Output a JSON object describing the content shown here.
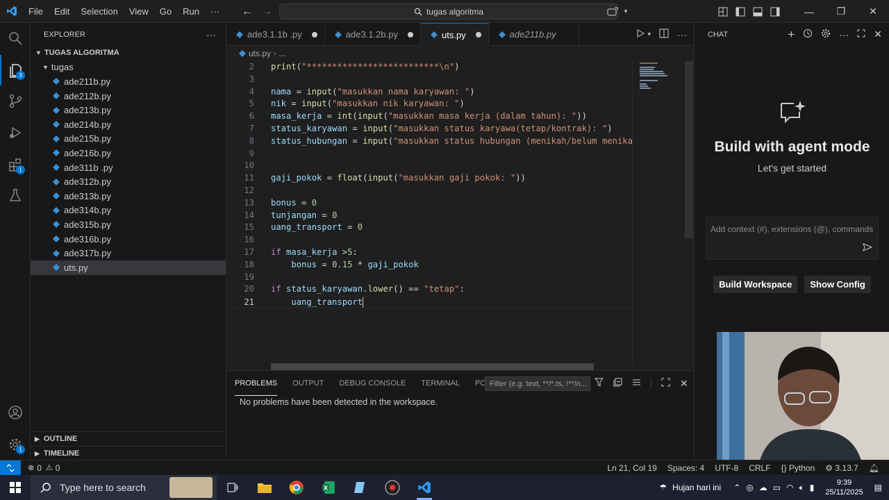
{
  "menu": [
    "File",
    "Edit",
    "Selection",
    "View",
    "Go",
    "Run",
    "···"
  ],
  "search": {
    "text": "tugas algoritma"
  },
  "explorer": {
    "header": "EXPLORER",
    "workspace": "TUGAS ALGORITMA",
    "folder": "tugas",
    "files": [
      "ade211b.py",
      "ade212b.py",
      "ade213b.py",
      "ade214b.py",
      "ade215b.py",
      "ade216b.py",
      "ade311b .py",
      "ade312b.py",
      "ade313b.py",
      "ade314b.py",
      "ade315b.py",
      "ade316b.py",
      "ade317b.py",
      "uts.py"
    ],
    "selected": "uts.py",
    "outline": "OUTLINE",
    "timeline": "TIMELINE"
  },
  "activity_badges": {
    "explorer": "3",
    "extensions": "1",
    "settings": "1"
  },
  "tabs": [
    {
      "label": "ade3.1.1b .py",
      "dirty": true,
      "active": false,
      "italic": false
    },
    {
      "label": "ade3.1.2b.py",
      "dirty": true,
      "active": false,
      "italic": false
    },
    {
      "label": "uts.py",
      "dirty": true,
      "active": true,
      "italic": false
    },
    {
      "label": "ade211b.py",
      "dirty": false,
      "active": false,
      "italic": true
    }
  ],
  "breadcrumb": [
    "uts.py",
    "..."
  ],
  "code_lines": [
    {
      "n": "2",
      "tokens": [
        [
          "fn",
          "print"
        ],
        [
          "op",
          "("
        ],
        [
          "st",
          "\"**************************\\n\""
        ],
        [
          "op",
          ")"
        ]
      ]
    },
    {
      "n": "3",
      "tokens": []
    },
    {
      "n": "4",
      "tokens": [
        [
          "vr",
          "nama"
        ],
        [
          "op",
          " = "
        ],
        [
          "fn",
          "input"
        ],
        [
          "op",
          "("
        ],
        [
          "st",
          "\"masukkan nama karyawan: \""
        ],
        [
          "op",
          ")"
        ]
      ]
    },
    {
      "n": "5",
      "tokens": [
        [
          "vr",
          "nik"
        ],
        [
          "op",
          " = "
        ],
        [
          "fn",
          "input"
        ],
        [
          "op",
          "("
        ],
        [
          "st",
          "\"masukkan nik karyawan: \""
        ],
        [
          "op",
          ")"
        ]
      ]
    },
    {
      "n": "6",
      "tokens": [
        [
          "vr",
          "masa_kerja"
        ],
        [
          "op",
          " = "
        ],
        [
          "fn",
          "int"
        ],
        [
          "op",
          "("
        ],
        [
          "fn",
          "input"
        ],
        [
          "op",
          "("
        ],
        [
          "st",
          "\"masukkan masa kerja (dalam tahun): \""
        ],
        [
          "op",
          "))"
        ]
      ]
    },
    {
      "n": "7",
      "tokens": [
        [
          "vr",
          "status_karyawan"
        ],
        [
          "op",
          " = "
        ],
        [
          "fn",
          "input"
        ],
        [
          "op",
          "("
        ],
        [
          "st",
          "\"masukkan status karyawa(tetap/kontrak): \""
        ],
        [
          "op",
          ")"
        ]
      ]
    },
    {
      "n": "8",
      "tokens": [
        [
          "vr",
          "status_hubungan"
        ],
        [
          "op",
          " = "
        ],
        [
          "fn",
          "input"
        ],
        [
          "op",
          "("
        ],
        [
          "st",
          "\"masukkan status hubungan (menikah/belum menikah"
        ]
      ]
    },
    {
      "n": "9",
      "tokens": []
    },
    {
      "n": "10",
      "tokens": []
    },
    {
      "n": "11",
      "tokens": [
        [
          "vr",
          "gaji_pokok"
        ],
        [
          "op",
          " = "
        ],
        [
          "fn",
          "float"
        ],
        [
          "op",
          "("
        ],
        [
          "fn",
          "input"
        ],
        [
          "op",
          "("
        ],
        [
          "st",
          "\"masukkan gaji pokok: \""
        ],
        [
          "op",
          "))"
        ]
      ]
    },
    {
      "n": "12",
      "tokens": []
    },
    {
      "n": "13",
      "tokens": [
        [
          "vr",
          "bonus"
        ],
        [
          "op",
          " = "
        ],
        [
          "nm",
          "0"
        ]
      ]
    },
    {
      "n": "14",
      "tokens": [
        [
          "vr",
          "tunjangan"
        ],
        [
          "op",
          " = "
        ],
        [
          "nm",
          "0"
        ]
      ]
    },
    {
      "n": "15",
      "tokens": [
        [
          "vr",
          "uang_transport"
        ],
        [
          "op",
          " = "
        ],
        [
          "nm",
          "0"
        ]
      ]
    },
    {
      "n": "16",
      "tokens": []
    },
    {
      "n": "17",
      "tokens": [
        [
          "kw",
          "if"
        ],
        [
          "op",
          " "
        ],
        [
          "vr",
          "masa_kerja"
        ],
        [
          "op",
          " >"
        ],
        [
          "nm",
          "5"
        ],
        [
          "op",
          ":"
        ]
      ]
    },
    {
      "n": "18",
      "tokens": [
        [
          "op",
          "    "
        ],
        [
          "vr",
          "bonus"
        ],
        [
          "op",
          " = "
        ],
        [
          "nm",
          "0.15"
        ],
        [
          "op",
          " * "
        ],
        [
          "vr",
          "gaji_pokok"
        ]
      ]
    },
    {
      "n": "19",
      "tokens": []
    },
    {
      "n": "20",
      "tokens": [
        [
          "kw",
          "if"
        ],
        [
          "op",
          " "
        ],
        [
          "vr",
          "status_karyawan"
        ],
        [
          "op",
          "."
        ],
        [
          "fn",
          "lower"
        ],
        [
          "op",
          "() == "
        ],
        [
          "st",
          "\"tetap\""
        ],
        [
          "op",
          ":"
        ]
      ]
    },
    {
      "n": "21",
      "tokens": [
        [
          "op",
          "    "
        ],
        [
          "vr",
          "uang_transport"
        ]
      ],
      "current": true
    }
  ],
  "panel": {
    "tabs": [
      "PROBLEMS",
      "OUTPUT",
      "DEBUG CONSOLE",
      "TERMINAL",
      "PORTS"
    ],
    "active_tab": "PROBLEMS",
    "filter_placeholder": "Filter (e.g. text, **/*.ts, !**/n...",
    "message": "No problems have been detected in the workspace."
  },
  "chat": {
    "header": "CHAT",
    "title": "Build with agent mode",
    "subtitle": "Let's get started",
    "input_placeholder": "Add context (#), extensions (@), commands",
    "buttons": [
      "Build Workspace",
      "Show Config"
    ]
  },
  "statusbar": {
    "problems": "0",
    "warnings": "0",
    "position": "Ln 21, Col 19",
    "spaces": "Spaces: 4",
    "encoding": "UTF-8",
    "eol": "CRLF",
    "language": "Python",
    "version": "3.13.7"
  },
  "taskbar": {
    "search": "Type here to search",
    "weather": "Hujan hari ini",
    "time": "9:39",
    "date": "25/11/2025"
  },
  "colors": {
    "accent": "#0078d4",
    "bg": "#1f1f1f",
    "sidebar": "#181818"
  }
}
